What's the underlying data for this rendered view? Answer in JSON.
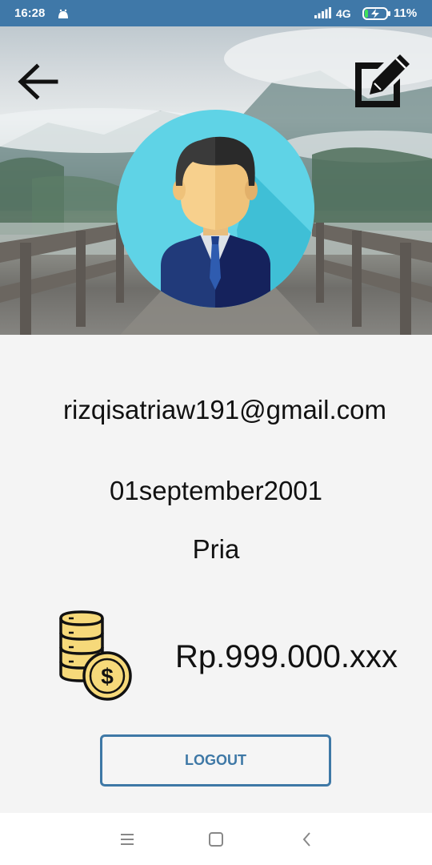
{
  "status_bar": {
    "time": "16:28",
    "network": "4G",
    "battery": "11%"
  },
  "profile": {
    "email": "rizqisatriaw191@gmail.com",
    "birthdate": "01september2001",
    "gender": "Pria",
    "balance": "Rp.999.000.xxx"
  },
  "actions": {
    "logout_label": "LOGOUT"
  },
  "icons": {
    "back": "back-arrow-icon",
    "edit": "edit-icon",
    "avatar": "user-avatar",
    "coins": "coins-icon",
    "nav_menu": "menu-icon",
    "nav_home": "home-icon",
    "nav_back": "back-icon"
  },
  "colors": {
    "status_bar": "#3f78a8",
    "accent": "#3e78a6",
    "avatar_bg": "#5fd3e6",
    "background": "#f4f4f4"
  }
}
